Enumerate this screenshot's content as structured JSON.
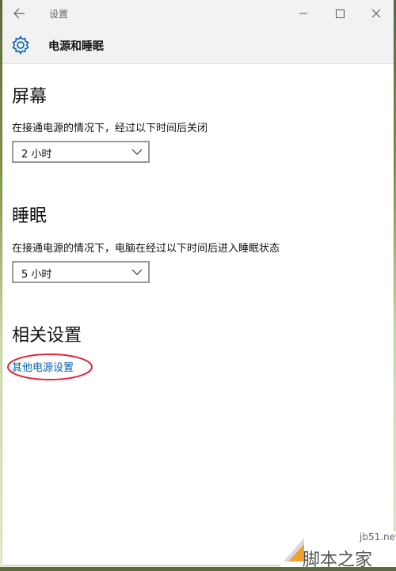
{
  "window": {
    "title": "设置",
    "page_title": "电源和睡眠"
  },
  "screen": {
    "title": "屏幕",
    "description": "在接通电源的情况下，经过以下时间后关闭",
    "value": "2 小时"
  },
  "sleep": {
    "title": "睡眠",
    "description": "在接通电源的情况下，电脑在经过以下时间后进入睡眠状态",
    "value": "5 小时"
  },
  "related": {
    "title": "相关设置",
    "link": "其他电源设置"
  },
  "watermark": {
    "site": "jb51.net",
    "brand": "脚本之家"
  },
  "icons": {
    "back": "back-arrow-icon",
    "minimize": "minimize-icon",
    "maximize": "maximize-icon",
    "close": "close-icon",
    "settings": "gear-icon",
    "dropdown": "chevron-down-icon"
  },
  "colors": {
    "accent": "#0063b1",
    "highlight_circle": "#e0283a"
  }
}
